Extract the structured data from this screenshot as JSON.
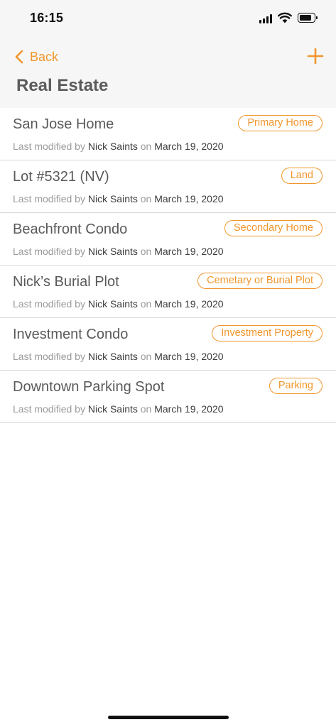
{
  "status_bar": {
    "time": "16:15"
  },
  "nav": {
    "back_label": "Back",
    "title": "Real Estate"
  },
  "properties": [
    {
      "name": "San Jose Home",
      "type": "Primary Home",
      "meta_prefix": "Last modified by",
      "modified_by": "Nick Saints",
      "meta_on": "on",
      "date": "March 19, 2020"
    },
    {
      "name": "Lot #5321 (NV)",
      "type": "Land",
      "meta_prefix": "Last modified by",
      "modified_by": "Nick Saints",
      "meta_on": "on",
      "date": "March 19, 2020"
    },
    {
      "name": "Beachfront Condo",
      "type": "Secondary Home",
      "meta_prefix": "Last modified by",
      "modified_by": "Nick Saints",
      "meta_on": "on",
      "date": "March 19, 2020"
    },
    {
      "name": "Nick’s Burial Plot",
      "type": "Cemetary or Burial Plot",
      "meta_prefix": "Last modified by",
      "modified_by": "Nick Saints",
      "meta_on": "on",
      "date": "March 19, 2020"
    },
    {
      "name": "Investment Condo",
      "type": "Investment Property",
      "meta_prefix": "Last modified by",
      "modified_by": "Nick Saints",
      "meta_on": "on",
      "date": "March 19, 2020"
    },
    {
      "name": "Downtown Parking Spot",
      "type": "Parking",
      "meta_prefix": "Last modified by",
      "modified_by": "Nick Saints",
      "meta_on": "on",
      "date": "March 19, 2020"
    }
  ],
  "icons": {
    "back": "chevron-left-icon",
    "add": "plus-icon",
    "signal": "cellular-signal-icon",
    "wifi": "wifi-icon",
    "battery": "battery-icon"
  },
  "colors": {
    "accent": "#f0962d",
    "header_bg": "#f6f6f6",
    "title": "#5b5b5b",
    "divider": "#d9d9d9"
  }
}
